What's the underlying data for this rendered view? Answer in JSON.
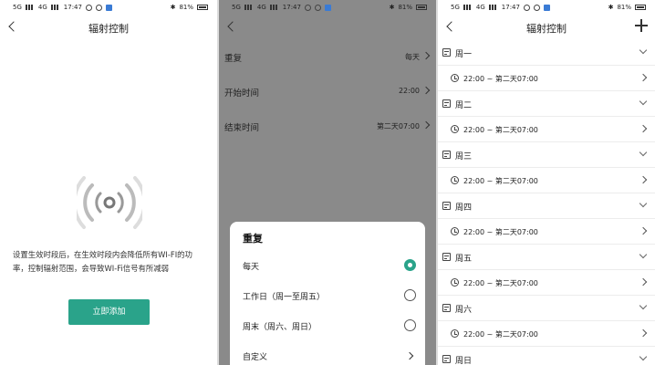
{
  "status": {
    "time": "17:47",
    "battery": "81%",
    "net_left": "5G",
    "net_mid": "4G"
  },
  "screen1": {
    "title": "辐射控制",
    "description": "设置生效时段后，在生效时段内会降低所有WI-FI的功率，控制辐射范围，会导致WI-Fi信号有所减弱",
    "add_button": "立即添加"
  },
  "screen2": {
    "rows": [
      {
        "label": "重复",
        "value": "每天"
      },
      {
        "label": "开始时间",
        "value": "22:00"
      },
      {
        "label": "结束时间",
        "value": "第二天07:00"
      }
    ],
    "sheet": {
      "title": "重复",
      "options": [
        {
          "label": "每天",
          "selected": true
        },
        {
          "label": "工作日（周一至周五）",
          "selected": false
        },
        {
          "label": "周末（周六、周日）",
          "selected": false
        },
        {
          "label": "自定义"
        }
      ]
    }
  },
  "screen3": {
    "title": "辐射控制",
    "days": [
      {
        "label": "周一",
        "slot": "22:00 ~ 第二天07:00"
      },
      {
        "label": "周二",
        "slot": "22:00 ~ 第二天07:00"
      },
      {
        "label": "周三",
        "slot": "22:00 ~ 第二天07:00"
      },
      {
        "label": "周四",
        "slot": "22:00 ~ 第二天07:00"
      },
      {
        "label": "周五",
        "slot": "22:00 ~ 第二天07:00"
      },
      {
        "label": "周六",
        "slot": "22:00 ~ 第二天07:00"
      },
      {
        "label": "周日"
      }
    ]
  },
  "colors": {
    "accent": "#2aa38a",
    "overlay": "#8a8a8a"
  }
}
